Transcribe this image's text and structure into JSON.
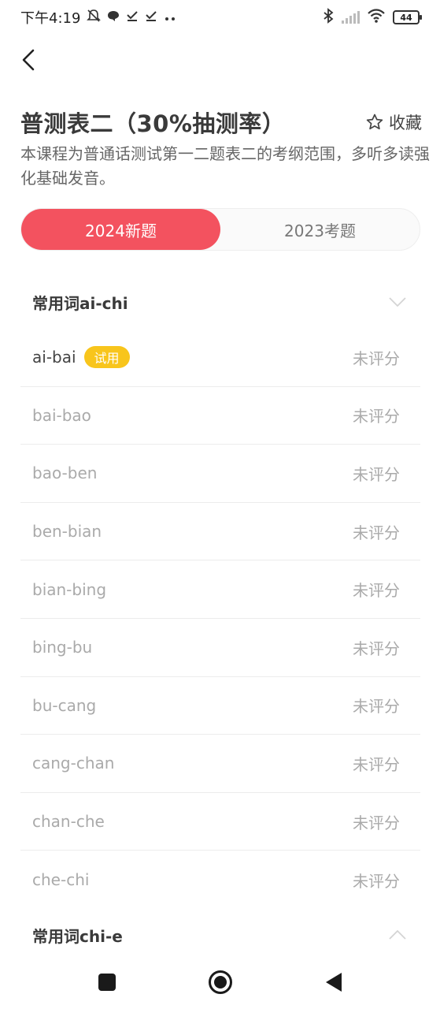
{
  "status_bar": {
    "time": "下午4:19",
    "battery": "44"
  },
  "header": {
    "title": "普测表二（30%抽测率）",
    "favorite_label": "收藏",
    "description": "本课程为普通话测试第一二题表二的考纲范围，多听多读强化基础发音。"
  },
  "tabs": [
    {
      "label": "2024新题",
      "active": true
    },
    {
      "label": "2023考题",
      "active": false
    }
  ],
  "sections": [
    {
      "title": "常用词ai-chi",
      "expanded": true,
      "items": [
        {
          "name": "ai-bai",
          "badge": "试用",
          "score": "未评分"
        },
        {
          "name": "bai-bao",
          "score": "未评分"
        },
        {
          "name": "bao-ben",
          "score": "未评分"
        },
        {
          "name": "ben-bian",
          "score": "未评分"
        },
        {
          "name": "bian-bing",
          "score": "未评分"
        },
        {
          "name": "bing-bu",
          "score": "未评分"
        },
        {
          "name": "bu-cang",
          "score": "未评分"
        },
        {
          "name": "cang-chan",
          "score": "未评分"
        },
        {
          "name": "chan-che",
          "score": "未评分"
        },
        {
          "name": "che-chi",
          "score": "未评分"
        }
      ]
    },
    {
      "title": "常用词chi-e",
      "expanded": false,
      "items": []
    }
  ],
  "colors": {
    "accent": "#f3525f",
    "badge": "#f8c51c"
  }
}
